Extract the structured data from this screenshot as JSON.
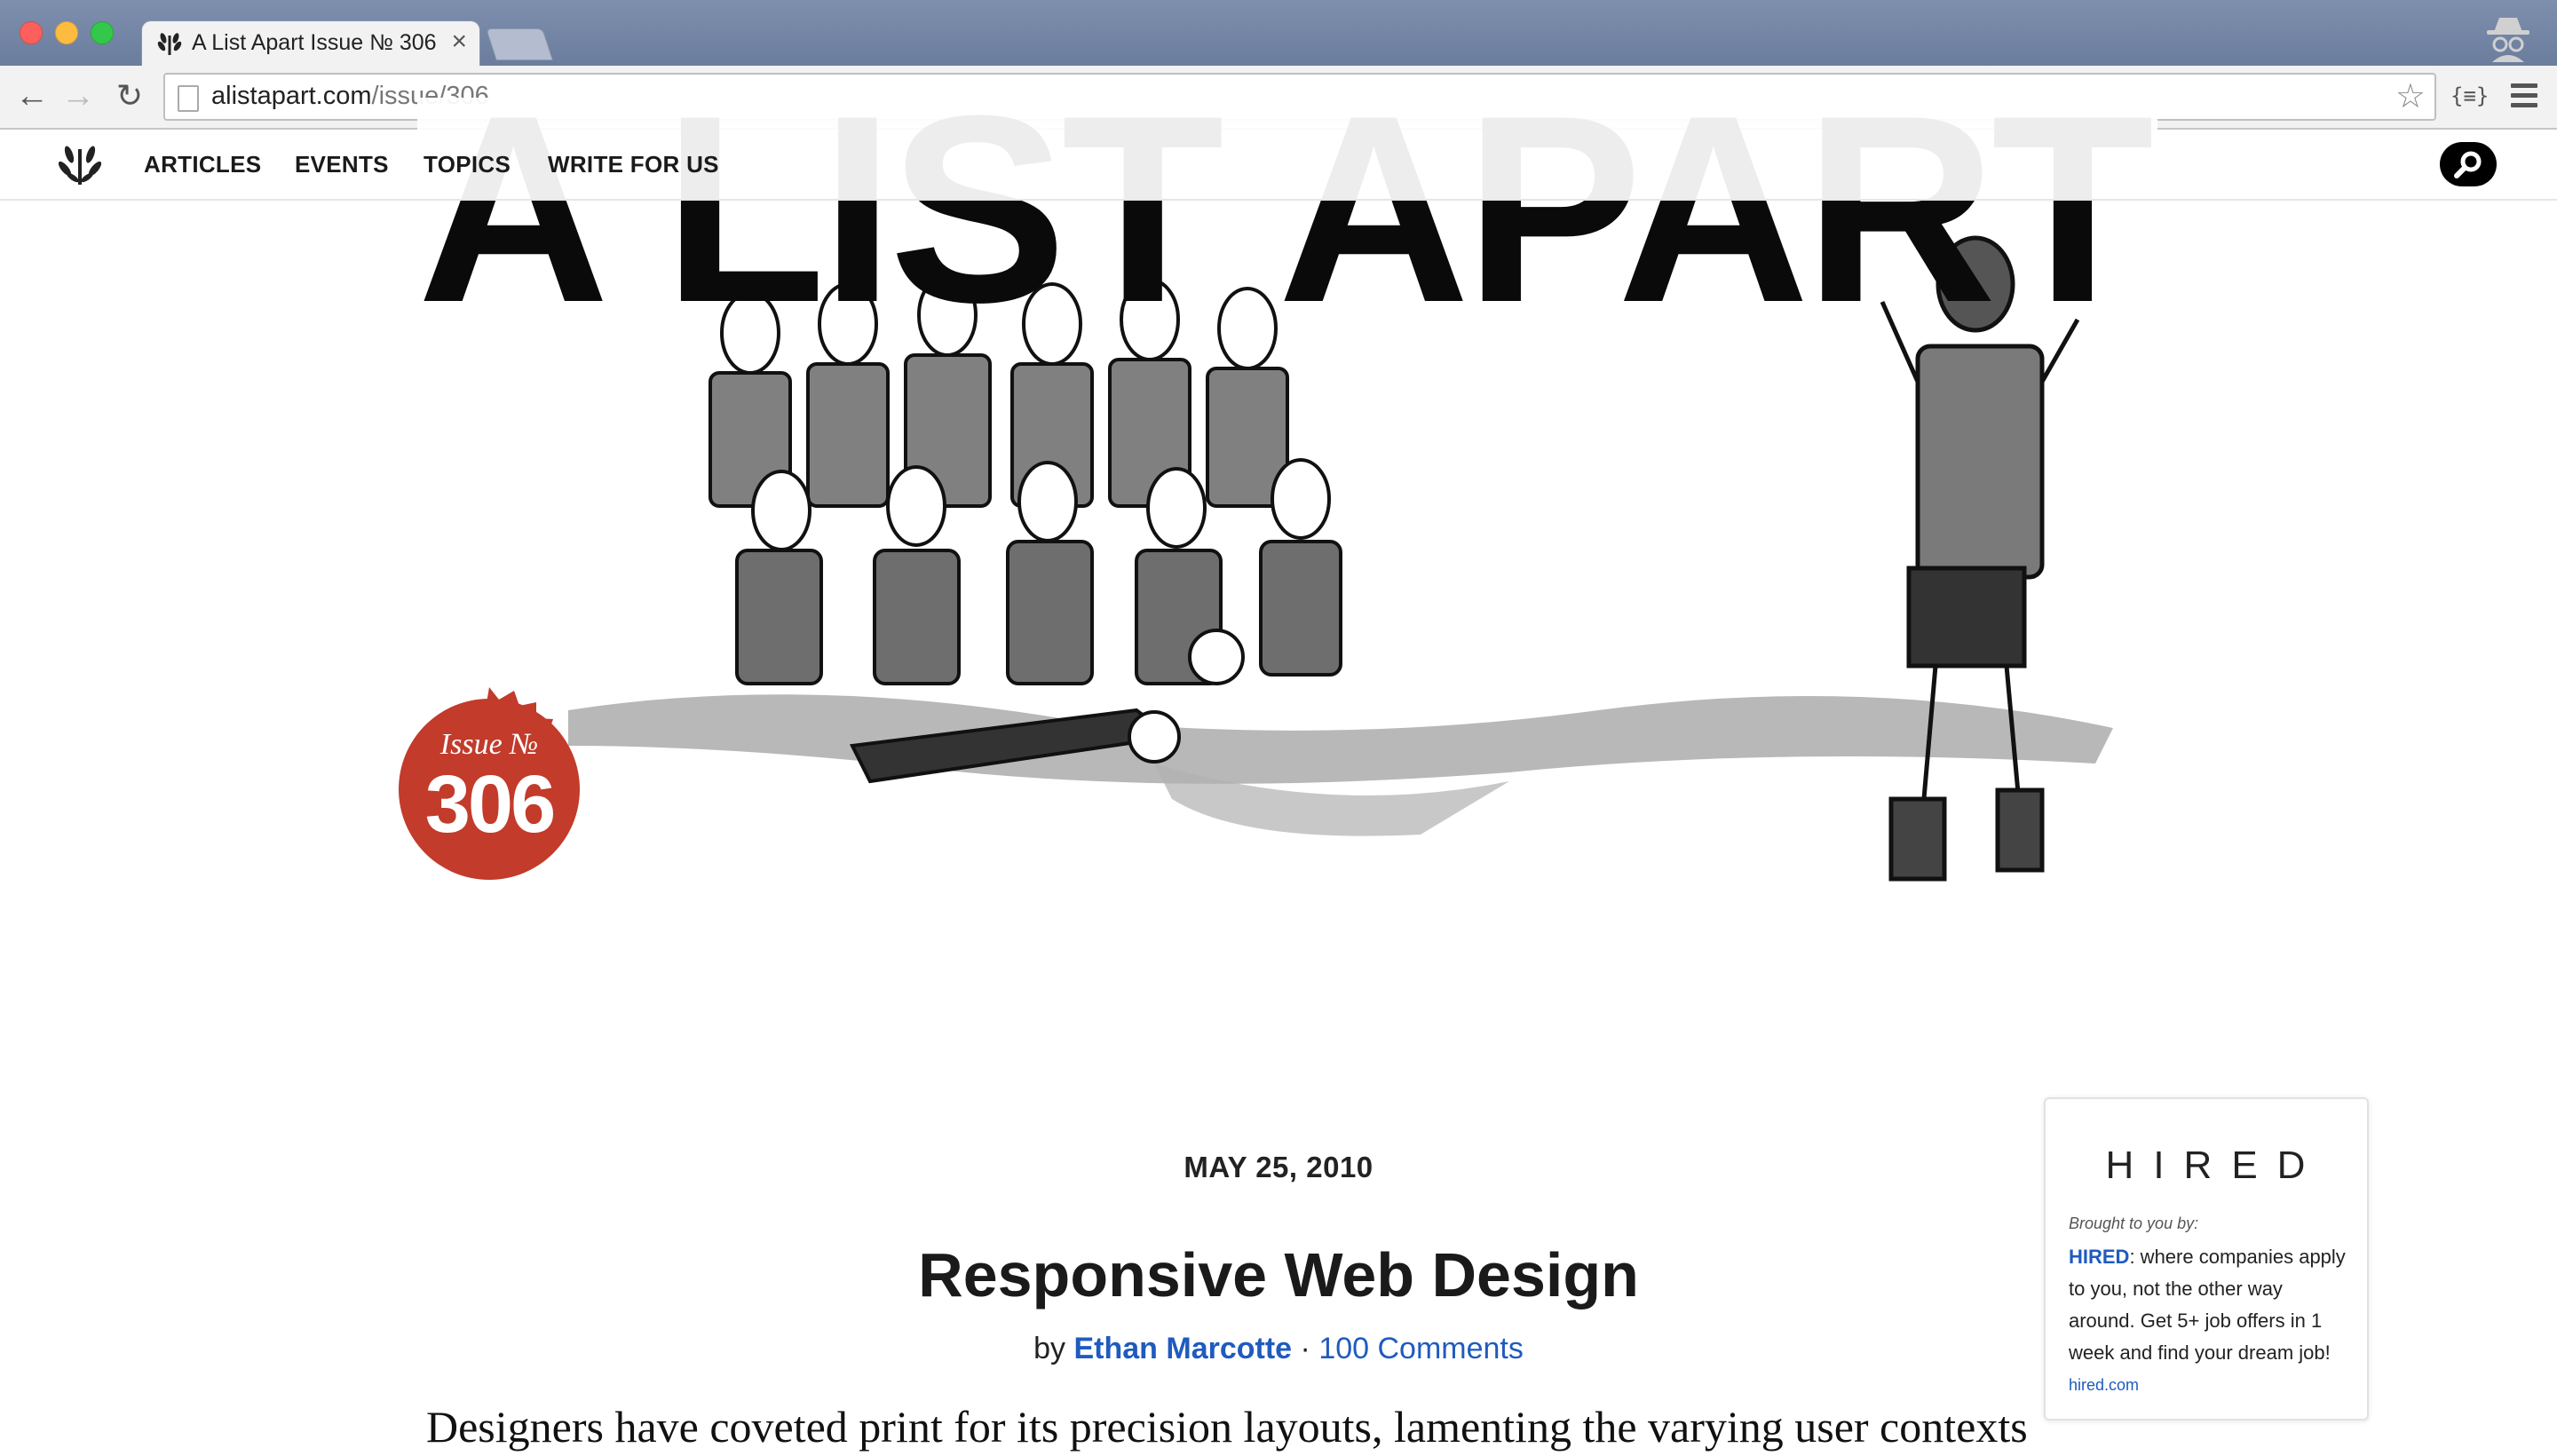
{
  "browser": {
    "tab_title": "A List Apart Issue № 306",
    "tab_close": "×",
    "url_domain": "alistapart.com",
    "url_path": "/issue/306",
    "ext_label": "{≡}"
  },
  "site_nav": {
    "links": [
      "ARTICLES",
      "EVENTS",
      "TOPICS",
      "WRITE FOR US"
    ]
  },
  "masthead": {
    "title": "A LIST APART"
  },
  "issue": {
    "label": "Issue №",
    "number": "306"
  },
  "article": {
    "date": "MAY 25, 2010",
    "title": "Responsive Web Design",
    "by": "by",
    "author": "Ethan Marcotte",
    "separator": " · ",
    "comments": "100 Comments",
    "lede": "Designers have coveted print for its precision layouts, lamenting the varying user contexts"
  },
  "ad": {
    "logo": "HIRED",
    "brought_by": "Brought to you by:",
    "brand": "HIRED",
    "copy": ": where companies apply to you, not the other way around. Get 5+ job offers in 1 week and find your dream job!",
    "link": "hired.com"
  },
  "colors": {
    "badge_red": "#c23b2b",
    "link_blue": "#1f5bbf"
  }
}
